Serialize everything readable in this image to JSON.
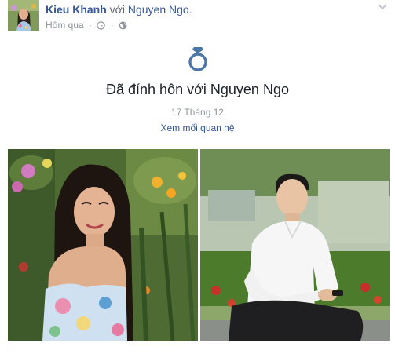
{
  "post": {
    "author": "Kieu Khanh",
    "with_word": "với",
    "tagged_friend": "Nguyen Ngo",
    "timestamp": "Hôm qua",
    "separator": "·",
    "event": {
      "title": "Đã đính hôn với Nguyen Ngo",
      "date": "17 Tháng 12",
      "link_label": "Xem mối quan hệ"
    }
  },
  "colors": {
    "link": "#365899",
    "ring_icon": "#4a76a8",
    "meta": "#90949c"
  }
}
